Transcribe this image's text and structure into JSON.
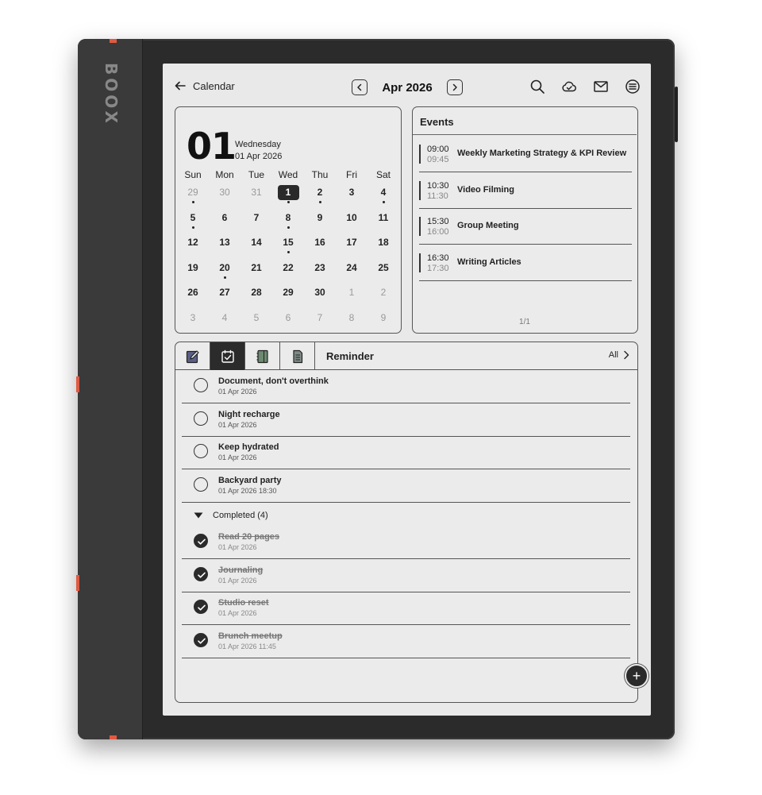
{
  "device": {
    "brand": "BOOX"
  },
  "header": {
    "back_label": "Calendar",
    "month_label": "Apr 2026"
  },
  "selected_day": {
    "big_number": "01",
    "weekday": "Wednesday",
    "full_date": "01 Apr 2026"
  },
  "calendar": {
    "weekdays": [
      "Sun",
      "Mon",
      "Tue",
      "Wed",
      "Thu",
      "Fri",
      "Sat"
    ],
    "days": [
      {
        "n": "29",
        "muted": true,
        "dot": true
      },
      {
        "n": "30",
        "muted": true,
        "dot": false
      },
      {
        "n": "31",
        "muted": true,
        "dot": false
      },
      {
        "n": "1",
        "today": true,
        "dot": true
      },
      {
        "n": "2",
        "dot": true
      },
      {
        "n": "3",
        "dot": false
      },
      {
        "n": "4",
        "dot": true
      },
      {
        "n": "5",
        "dot": true
      },
      {
        "n": "6",
        "dot": false
      },
      {
        "n": "7",
        "dot": false
      },
      {
        "n": "8",
        "dot": true
      },
      {
        "n": "9",
        "dot": false
      },
      {
        "n": "10",
        "dot": false
      },
      {
        "n": "11",
        "dot": false
      },
      {
        "n": "12",
        "dot": false
      },
      {
        "n": "13",
        "dot": false
      },
      {
        "n": "14",
        "dot": false
      },
      {
        "n": "15",
        "dot": true
      },
      {
        "n": "16",
        "dot": false
      },
      {
        "n": "17",
        "dot": false
      },
      {
        "n": "18",
        "dot": false
      },
      {
        "n": "19",
        "dot": false
      },
      {
        "n": "20",
        "dot": true
      },
      {
        "n": "21",
        "dot": false
      },
      {
        "n": "22",
        "dot": false
      },
      {
        "n": "23",
        "dot": false
      },
      {
        "n": "24",
        "dot": false
      },
      {
        "n": "25",
        "dot": false
      },
      {
        "n": "26",
        "dot": false
      },
      {
        "n": "27",
        "dot": false
      },
      {
        "n": "28",
        "dot": false
      },
      {
        "n": "29",
        "dot": false
      },
      {
        "n": "30",
        "dot": false
      },
      {
        "n": "1",
        "muted": true,
        "dot": false
      },
      {
        "n": "2",
        "muted": true,
        "dot": false
      },
      {
        "n": "3",
        "muted": true,
        "dot": false
      },
      {
        "n": "4",
        "muted": true,
        "dot": false
      },
      {
        "n": "5",
        "muted": true,
        "dot": false
      },
      {
        "n": "6",
        "muted": true,
        "dot": false
      },
      {
        "n": "7",
        "muted": true,
        "dot": false
      },
      {
        "n": "8",
        "muted": true,
        "dot": false
      },
      {
        "n": "9",
        "muted": true,
        "dot": false
      }
    ]
  },
  "events": {
    "title": "Events",
    "items": [
      {
        "start": "09:00",
        "end": "09:45",
        "title": "Weekly Marketing Strategy & KPI Review"
      },
      {
        "start": "10:30",
        "end": "11:30",
        "title": "Video Filming"
      },
      {
        "start": "15:30",
        "end": "16:00",
        "title": "Group Meeting"
      },
      {
        "start": "16:30",
        "end": "17:30",
        "title": "Writing Articles"
      }
    ],
    "page": "1/1"
  },
  "reminder": {
    "label": "Reminder",
    "all_label": "All",
    "tab_icons": [
      "notes-icon",
      "checklist-icon",
      "notebook-icon",
      "document-icon"
    ],
    "active_tab": 1,
    "tasks": [
      {
        "name": "Document, don't overthink",
        "date": "01 Apr 2026"
      },
      {
        "name": "Night recharge",
        "date": "01 Apr 2026"
      },
      {
        "name": "Keep hydrated",
        "date": "01 Apr 2026"
      },
      {
        "name": "Backyard party",
        "date": "01 Apr 2026 18:30"
      }
    ],
    "completed_label": "Completed (4)",
    "completed": [
      {
        "name": "Read 20 pages",
        "date": "01 Apr 2026"
      },
      {
        "name": "Journaling",
        "date": "01 Apr 2026"
      },
      {
        "name": "Studio reset",
        "date": "01 Apr 2026"
      },
      {
        "name": "Brunch meetup",
        "date": "01 Apr 2026 11:45"
      }
    ]
  },
  "fab_label": "+",
  "colors": {
    "screen": "#e9e9e9",
    "ink": "#222222",
    "accent": "#e05a43",
    "tab_blue": "#5a5f86",
    "tab_green": "#6b8a71",
    "tab_gray": "#7d8a86"
  }
}
